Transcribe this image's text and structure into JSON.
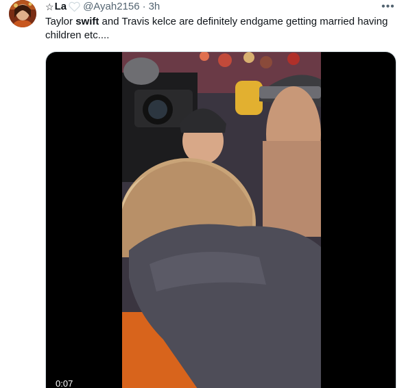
{
  "tweet": {
    "author": {
      "star_glyph": "☆",
      "display_name": "La",
      "handle": "@Ayah2156",
      "separator": "·",
      "time": "3h",
      "avatar_icon": "profile-avatar",
      "badge_icon": "heart-icon"
    },
    "more_label": "•••",
    "text": {
      "part1": "Taylor ",
      "part2_bold": "swift",
      "part3": " and Travis kelce are definitely endgame getting married having children etc...."
    },
    "media": {
      "type": "video",
      "timestamp": "0:07"
    }
  },
  "colors": {
    "text_primary": "#0f1419",
    "text_secondary": "#536471",
    "media_bg": "#000000",
    "border": "#cfd9de"
  }
}
